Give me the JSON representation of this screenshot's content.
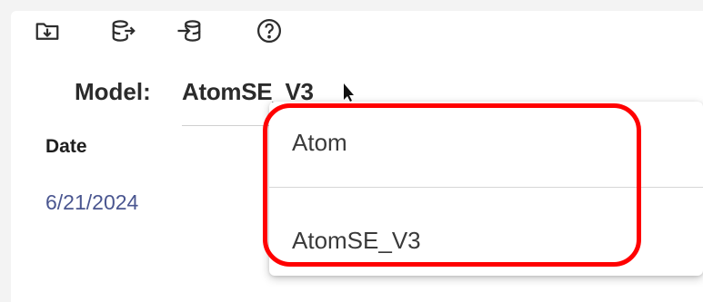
{
  "toolbar": {
    "icons": [
      "folder-download-icon",
      "database-export-icon",
      "database-import-icon",
      "help-icon"
    ]
  },
  "model": {
    "label": "Model:",
    "value": "AtomSE_V3"
  },
  "table": {
    "columns": [
      "Date"
    ],
    "rows": [
      [
        "6/21/2024"
      ]
    ]
  },
  "dropdown": {
    "options": [
      "Atom",
      "AtomSE_V3"
    ]
  },
  "colors": {
    "highlight": "#ff0000",
    "date_text": "#4a5690"
  }
}
